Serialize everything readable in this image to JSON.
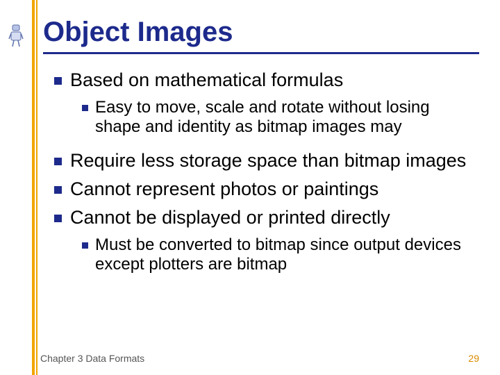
{
  "title": "Object Images",
  "bullets": {
    "b1": "Based on mathematical formulas",
    "b1a": "Easy to move, scale and rotate without losing shape and identity as bitmap images may",
    "b2": "Require less storage space than bitmap images",
    "b3": "Cannot represent photos or paintings",
    "b4": "Cannot be displayed or printed directly",
    "b4a": "Must be converted to bitmap since output devices except plotters are bitmap"
  },
  "footer": {
    "chapter": "Chapter 3 Data Formats",
    "page": "29"
  }
}
